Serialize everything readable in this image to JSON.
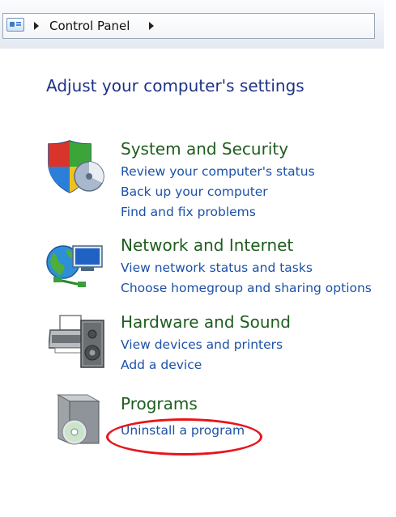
{
  "address_bar": {
    "breadcrumb": "Control Panel"
  },
  "page": {
    "title": "Adjust your computer's settings"
  },
  "categories": [
    {
      "title": "System and Security",
      "icon": "shield-icon",
      "links": [
        "Review your computer's status",
        "Back up your computer",
        "Find and fix problems"
      ]
    },
    {
      "title": "Network and Internet",
      "icon": "network-globe-icon",
      "links": [
        "View network status and tasks",
        "Choose homegroup and sharing options"
      ]
    },
    {
      "title": "Hardware and Sound",
      "icon": "printer-speaker-icon",
      "links": [
        "View devices and printers",
        "Add a device"
      ]
    },
    {
      "title": "Programs",
      "icon": "programs-box-icon",
      "links": [
        "Uninstall a program"
      ]
    }
  ],
  "colors": {
    "page_title": "#1e3287",
    "category_title": "#1e5d1e",
    "link": "#1c51a8",
    "highlight": "#e8141b"
  }
}
